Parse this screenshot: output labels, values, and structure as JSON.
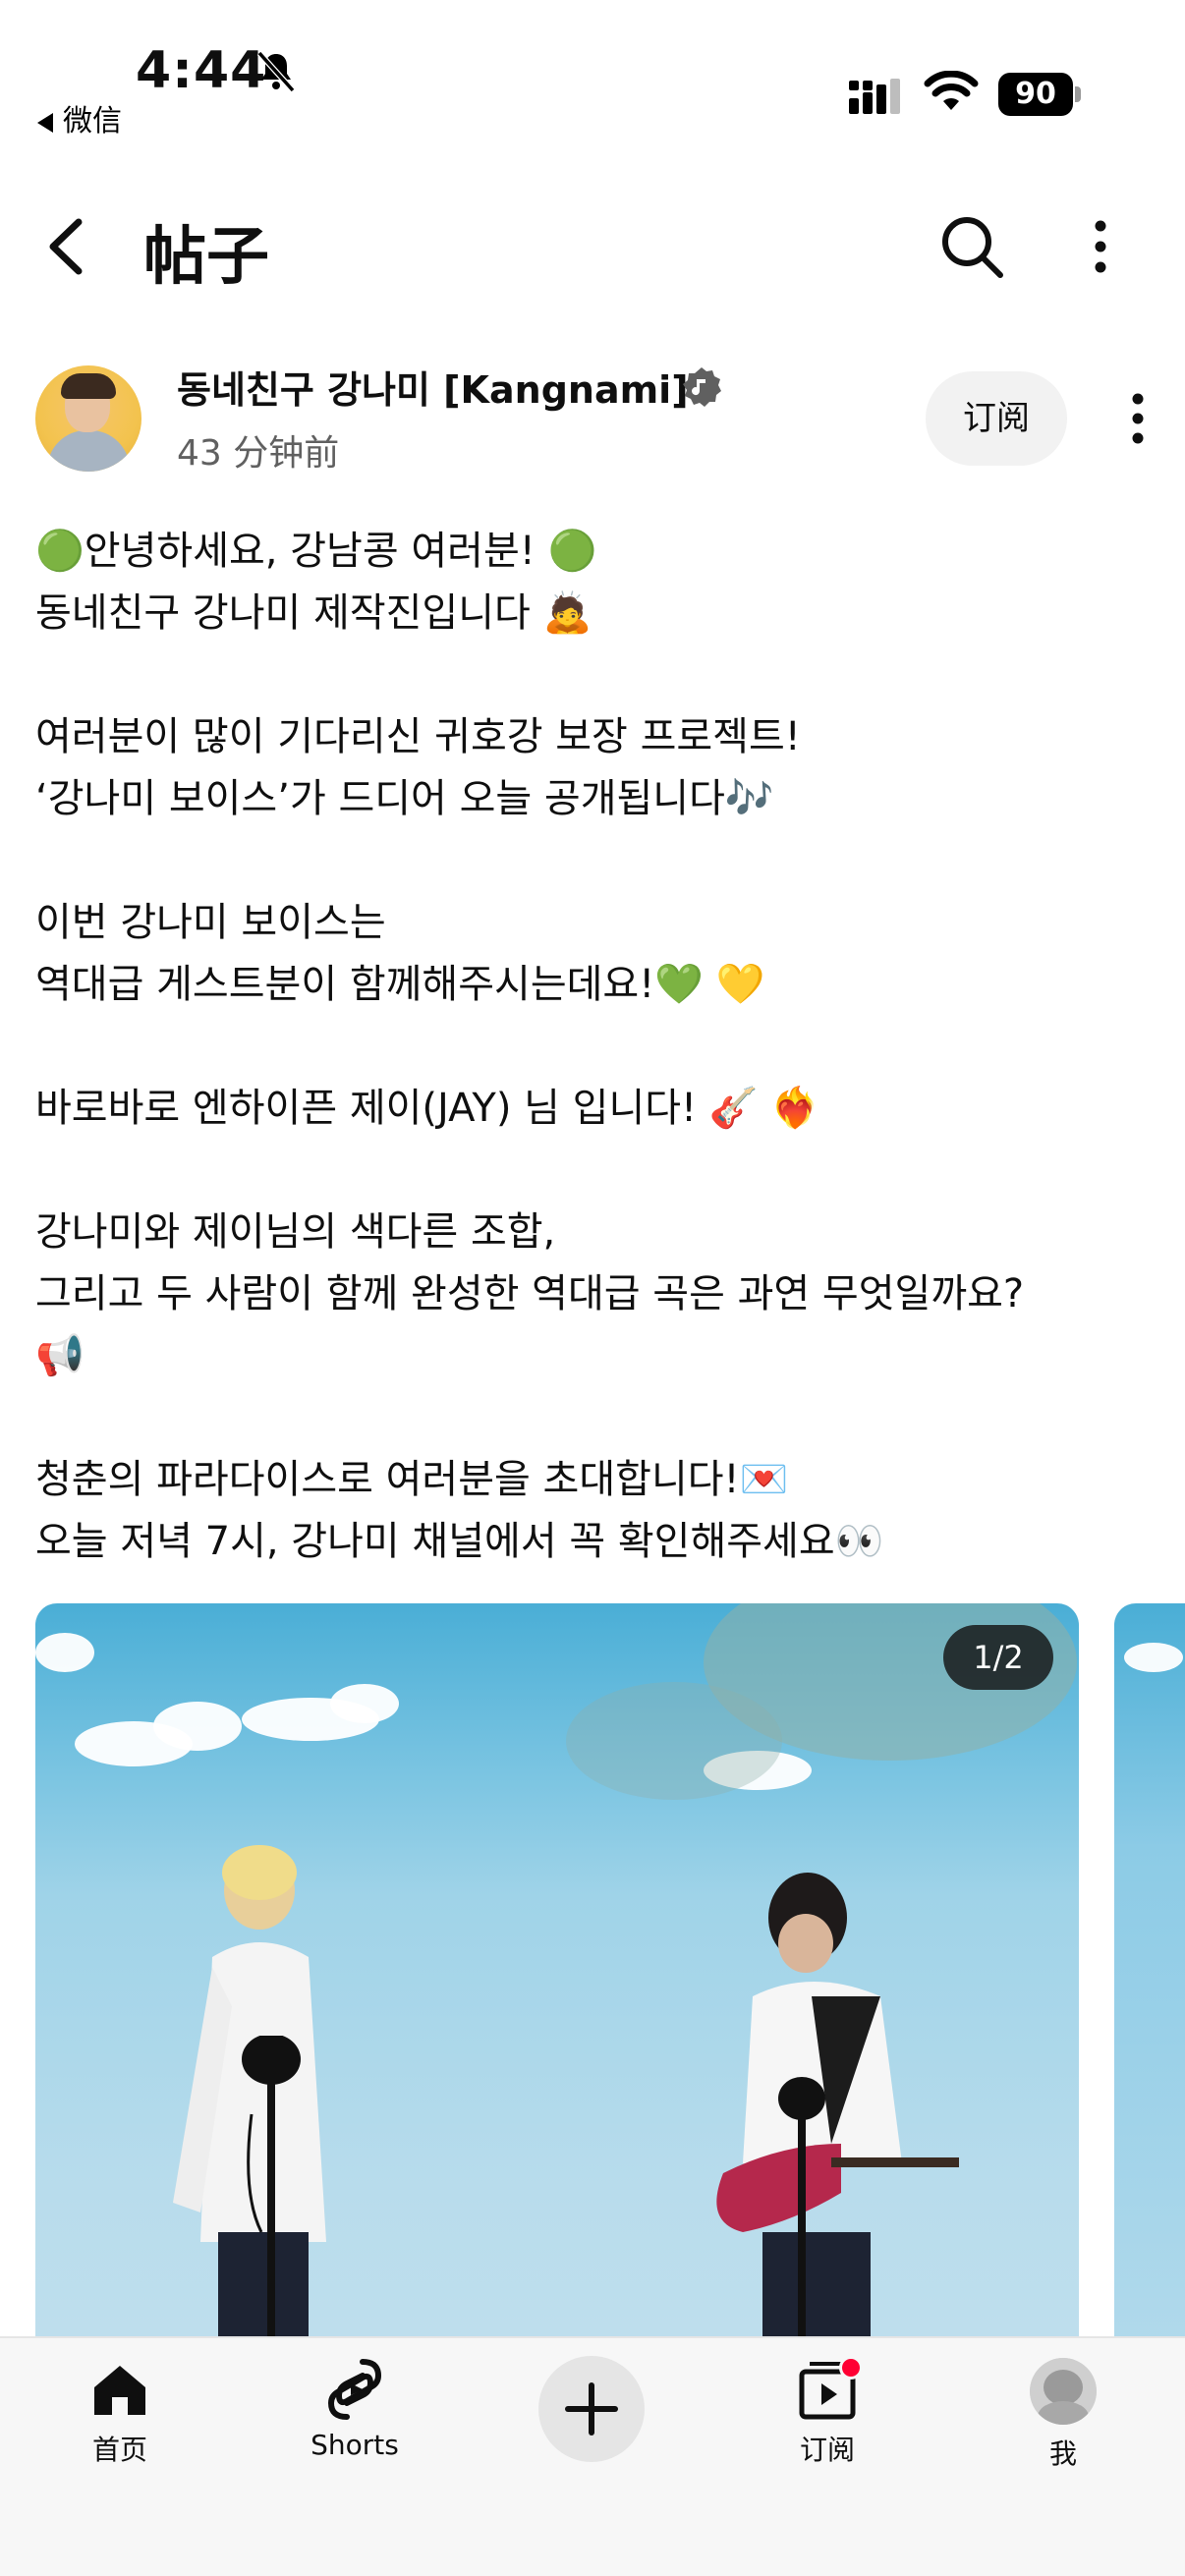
{
  "status_bar": {
    "time": "4:44",
    "back_app": "微信",
    "battery": "90"
  },
  "header": {
    "title": "帖子"
  },
  "post": {
    "channel_name": "동네친구 강나미 [Kangnami]",
    "time_ago": "43 分钟前",
    "subscribe_label": "订阅",
    "lines": [
      "🟢안녕하세요, 강남콩 여러분! 🟢",
      "동네친구 강나미 제작진입니다 🙇",
      "",
      "여러분이 많이 기다리신 귀호강 보장 프로젝트!",
      "‘강나미 보이스’가 드디어 오늘 공개됩니다🎶",
      "",
      "이번 강나미 보이스는",
      "역대급 게스트분이 함께해주시는데요!💚 💛",
      "",
      "바로바로 엔하이픈 제이(JAY) 님 입니다! 🎸 ❤️‍🔥",
      "",
      "강나미와 제이님의 색다른 조합,",
      "그리고 두 사람이 함께 완성한 역대급 곡은 과연 무엇일까요?",
      "📢",
      "",
      "청춘의 파라다이스로 여러분을 초대합니다!💌",
      "오늘 저녁 7시, 강나미 채널에서 꼭 확인해주세요👀"
    ],
    "image_counter": "1/2"
  },
  "bottom_nav": {
    "home": "首页",
    "shorts": "Shorts",
    "subscriptions": "订阅",
    "me": "我"
  },
  "colors": {
    "accent_red": "#ff0033",
    "text_primary": "#0f0f0f",
    "text_secondary": "#606060",
    "button_bg": "#f2f2f2"
  }
}
